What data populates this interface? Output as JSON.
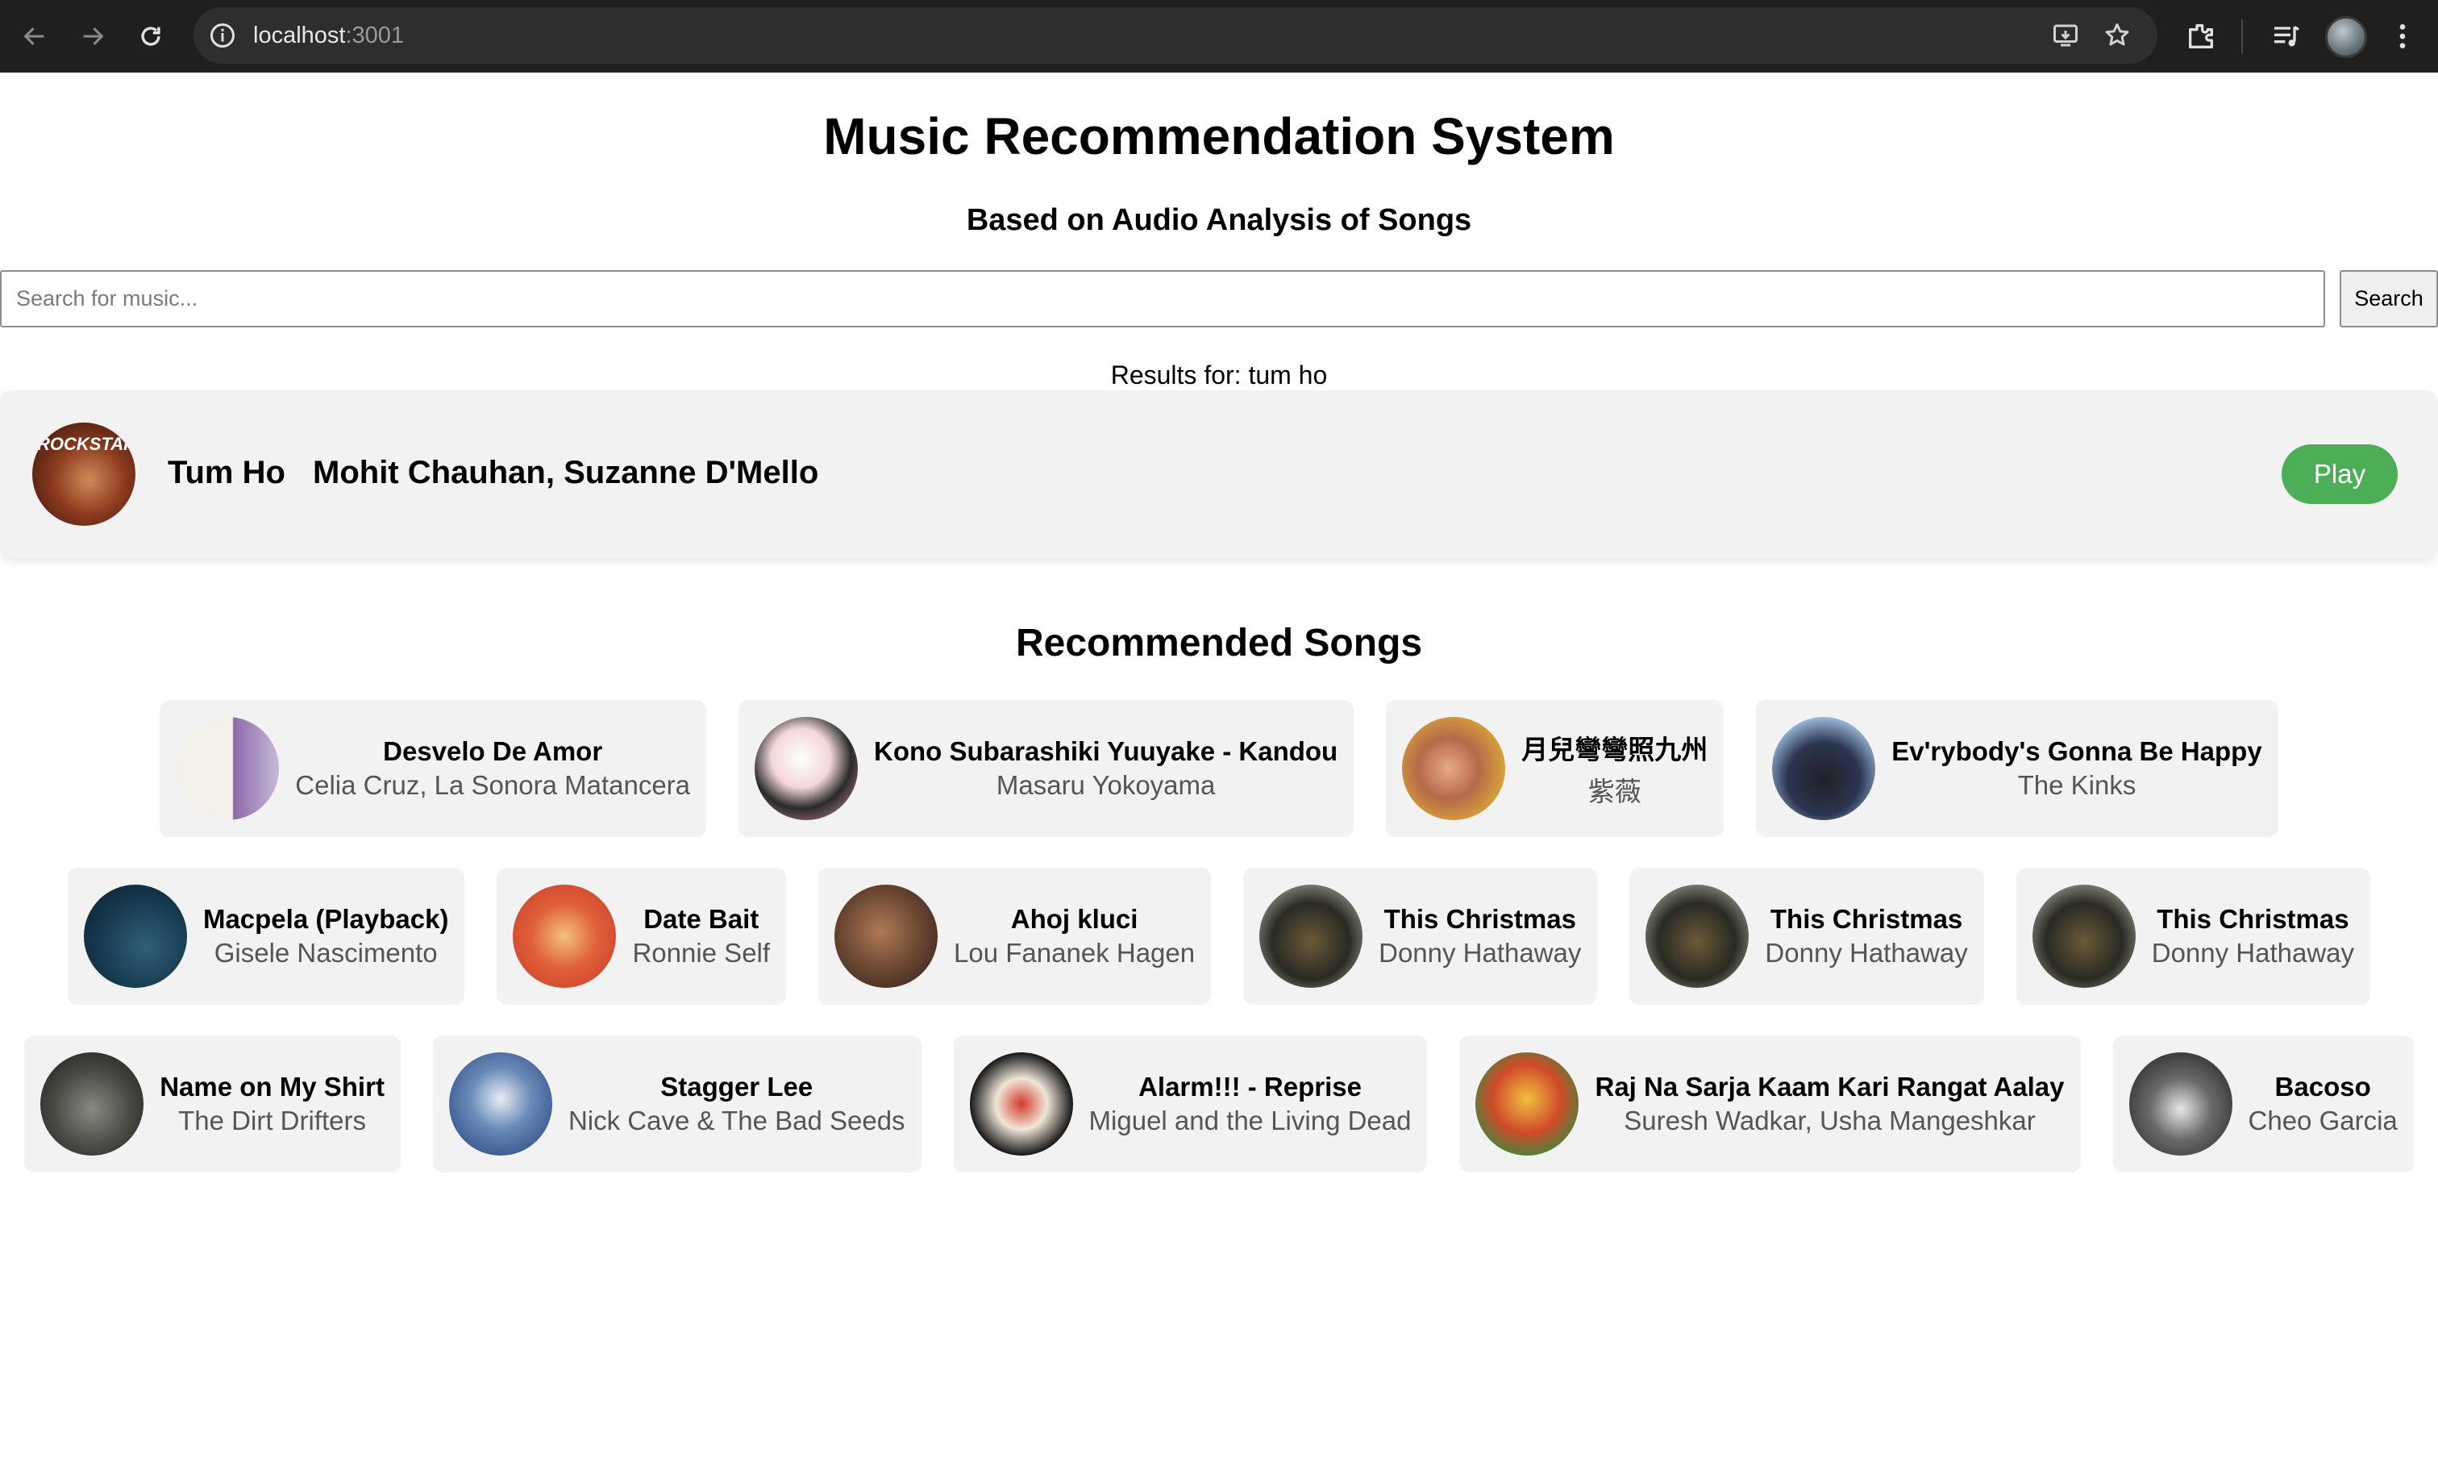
{
  "browser": {
    "url_host": "localhost",
    "url_port": ":3001"
  },
  "header": {
    "title": "Music Recommendation System",
    "subtitle": "Based on Audio Analysis of Songs"
  },
  "search": {
    "placeholder": "Search for music...",
    "value": "",
    "button_label": "Search"
  },
  "results": {
    "label": "Results for: tum ho",
    "track": {
      "title": "Tum Ho",
      "artist": "Mohit Chauhan, Suzanne D'Mello",
      "art_text": "ROCKSTAR",
      "play_label": "Play"
    }
  },
  "recommended": {
    "heading": "Recommended Songs",
    "rows": [
      [
        {
          "title": "Desvelo De Amor",
          "artist": "Celia Cruz, La Sonora Matancera",
          "art": "linear-gradient(90deg,#f4f1ea 0%,#f4f1ea 55%,#8a6aa8 56%,#c8b8d8 100%)"
        },
        {
          "title": "Kono Subarashiki Yuuyake - Kandou",
          "artist": "Masaru Yokoyama",
          "art": "radial-gradient(circle at 45% 40%,#ffffff 0%,#f3d7d9 35%,#2a2a2a 60%,#e49bb5 100%)"
        },
        {
          "title": "月兒彎彎照九州",
          "artist": "紫薇",
          "art": "radial-gradient(circle at 45% 50%,#e8a98a 0%,#b56a4a 40%,#d9a23a 75%,#e88a3a 100%)"
        },
        {
          "title": "Ev'rybody's Gonna Be Happy",
          "artist": "The Kinks",
          "art": "radial-gradient(circle at 50% 60%,#202028 0%,#2b3550 45%,#a9c7e8 80%,#e6e6e6 100%)"
        }
      ],
      [
        {
          "title": "Macpela (Playback)",
          "artist": "Gisele Nascimento",
          "art": "radial-gradient(circle at 60% 60%,#2f5f7a 0%,#16384c 55%,#0b1f2c 100%)"
        },
        {
          "title": "Date Bait",
          "artist": "Ronnie Self",
          "art": "radial-gradient(circle at 50% 50%,#f2c27a 0%,#e0603a 45%,#c73a28 100%)"
        },
        {
          "title": "Ahoj kluci",
          "artist": "Lou Fananek Hagen",
          "art": "radial-gradient(circle at 45% 45%,#b07a56 0%,#6a4632 50%,#2a1c18 100%)"
        },
        {
          "title": "This Christmas",
          "artist": "Donny Hathaway",
          "art": "radial-gradient(circle at 50% 55%,#6a5a3a 0%,#2a2a22 50%,#8a8a80 80%,#d8d8d0 100%)"
        },
        {
          "title": "This Christmas",
          "artist": "Donny Hathaway",
          "art": "radial-gradient(circle at 50% 55%,#6a5a3a 0%,#2a2a22 50%,#8a8a80 80%,#d8d8d0 100%)"
        },
        {
          "title": "This Christmas",
          "artist": "Donny Hathaway",
          "art": "radial-gradient(circle at 50% 55%,#6a5a3a 0%,#2a2a22 50%,#8a8a80 80%,#d8d8d0 100%)"
        }
      ],
      [
        {
          "title": "Name on My Shirt",
          "artist": "The Dirt Drifters",
          "art": "radial-gradient(circle at 50% 55%,#8a8a82 0%,#4a4a44 50%,#1a1a18 100%)"
        },
        {
          "title": "Stagger Lee",
          "artist": "Nick Cave & The Bad Seeds",
          "art": "radial-gradient(circle at 50% 45%,#e8eef6 0%,#6a8ab8 40%,#1e3c78 100%)"
        },
        {
          "title": "Alarm!!! - Reprise",
          "artist": "Miguel and the Living Dead",
          "art": "radial-gradient(circle at 50% 50%,#d23a2a 0%,#f0e6d8 35%,#1a1a1a 70%,#888 100%)"
        },
        {
          "title": "Raj Na Sarja Kaam Kari Rangat Aalay",
          "artist": "Suresh Wadkar, Usha Mangeshkar",
          "art": "radial-gradient(circle at 50% 45%,#f0c040 0%,#d04a2a 45%,#3a8a3a 80%,#1a5a2a 100%)"
        },
        {
          "title": "Bacoso",
          "artist": "Cheo Garcia",
          "art": "radial-gradient(circle at 50% 55%,#e8e8e8 0%,#6a6a6a 40%,#1a1a1a 100%)"
        }
      ]
    ]
  }
}
